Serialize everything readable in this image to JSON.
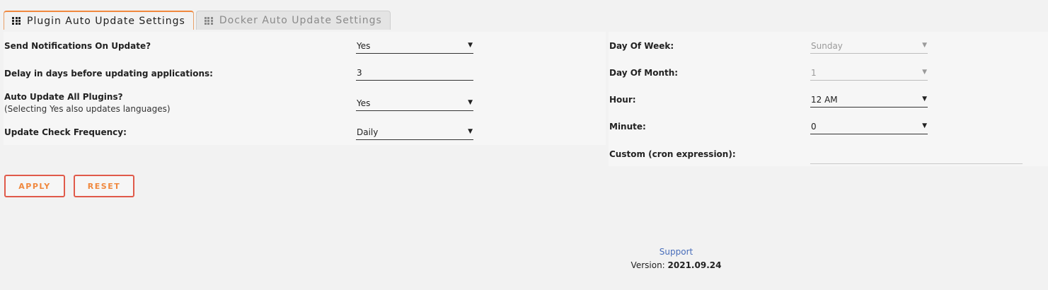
{
  "tabs": [
    {
      "label": "Plugin Auto Update Settings",
      "active": true
    },
    {
      "label": "Docker Auto Update Settings",
      "active": false
    }
  ],
  "left": {
    "notifications": {
      "label": "Send Notifications On Update?",
      "value": "Yes"
    },
    "delay": {
      "label": "Delay in days before updating applications:",
      "value": "3"
    },
    "auto_update_all": {
      "label": "Auto Update All Plugins?",
      "sublabel": "(Selecting Yes also updates languages)",
      "value": "Yes"
    },
    "frequency": {
      "label": "Update Check Frequency:",
      "value": "Daily"
    }
  },
  "right": {
    "day_of_week": {
      "label": "Day Of Week:",
      "value": "Sunday"
    },
    "day_of_month": {
      "label": "Day Of Month:",
      "value": "1"
    },
    "hour": {
      "label": "Hour:",
      "value": "12 AM"
    },
    "minute": {
      "label": "Minute:",
      "value": "0"
    },
    "custom": {
      "label": "Custom (cron expression):",
      "value": ""
    }
  },
  "buttons": {
    "apply": "APPLY",
    "reset": "RESET"
  },
  "footer": {
    "support": "Support",
    "version_label": "Version: ",
    "version": "2021.09.24"
  },
  "icons": {
    "caret": "▼",
    "tab_icon": "grid-icon"
  },
  "colors": {
    "accent": "#f0883e",
    "button_border": "#e05a4a",
    "link": "#486dba"
  }
}
